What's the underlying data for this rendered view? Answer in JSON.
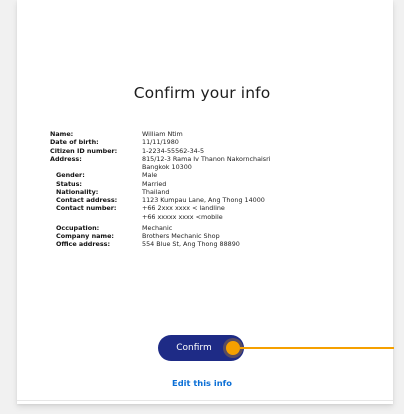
{
  "page": {
    "title": "Confirm your info"
  },
  "info_rows": [
    {
      "label": "Name:",
      "value": "William Ntim"
    },
    {
      "label": "Date of birth:",
      "value": "11/11/1980"
    },
    {
      "label": "Citizen ID number:",
      "value": "1-2234-55562-34-5"
    },
    {
      "label": "Address:",
      "value": "815/12-3 Rama Iv Thanon Nakornchaisri"
    },
    {
      "label": "",
      "value": "Bangkok 10300"
    },
    {
      "label": "Gender:",
      "value": "Male"
    },
    {
      "label": "Status:",
      "value": "Married"
    },
    {
      "label": "Nationality:",
      "value": "Thailand"
    },
    {
      "label": "Contact address:",
      "value": "1123 Kumpau Lane, Ang Thong 14000"
    },
    {
      "label": "Contact number:",
      "value": "+66 2xxx xxxx < landline"
    },
    {
      "label": "",
      "value": "+66 xxxxx xxxx <mobile"
    },
    {
      "label": "Occupation:",
      "value": "Mechanic"
    },
    {
      "label": "Company name:",
      "value": "Brothers Mechanic Shop"
    },
    {
      "label": "Office address:",
      "value": "554 Blue St, Ang Thong 88890"
    }
  ],
  "actions": {
    "confirm_label": "Confirm",
    "edit_label": "Edit this info"
  },
  "colors": {
    "confirm_button": "#1e2b86",
    "pointer": "#f5a000",
    "link": "#0b6fd6"
  }
}
